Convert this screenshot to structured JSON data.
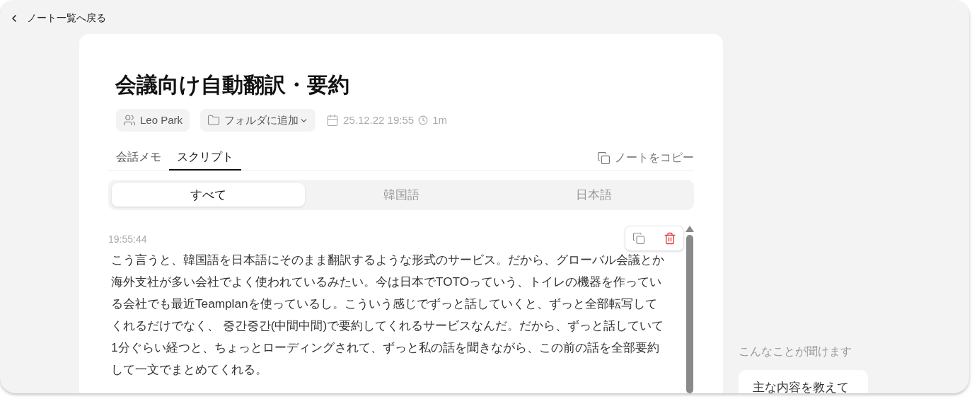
{
  "back_link": "ノート一覧へ戻る",
  "note": {
    "title": "会議向け自動翻訳・要約",
    "author": "Leo Park",
    "folder_button": "フォルダに追加",
    "date": "25.12.22 19:55",
    "duration": "1m"
  },
  "tabs": [
    {
      "label": "会話メモ",
      "selected": false
    },
    {
      "label": "スクリプト",
      "selected": true
    }
  ],
  "copy_note": "ノートをコピー",
  "language_filter": [
    {
      "label": "すべて",
      "selected": true
    },
    {
      "label": "韓国語",
      "selected": false
    },
    {
      "label": "日本語",
      "selected": false
    }
  ],
  "transcript": [
    {
      "time": "19:55:44",
      "text": "こう言うと、韓国語を日本語にそのまま翻訳するような形式のサービス。だから、グローバル会議とか海外支社が多い会社でよく使われているみたい。今は日本でTOTOっていう、トイレの機器を作っている会社でも最近Teamplanを使っているし。こういう感じでずっと話していくと、ずっと全部転写してくれるだけでなく、 중간중간(中間中間)で要約してくれるサービスなんだ。だから、ずっと話していて1分ぐらい経つと、ちょっとローディングされて、ずっと私の話を聞きながら、この前の話を全部要約して一文でまとめてくれる。"
    }
  ],
  "suggestions": {
    "heading": "こんなことが聞けます",
    "items": [
      "主な内容を教えて"
    ]
  }
}
